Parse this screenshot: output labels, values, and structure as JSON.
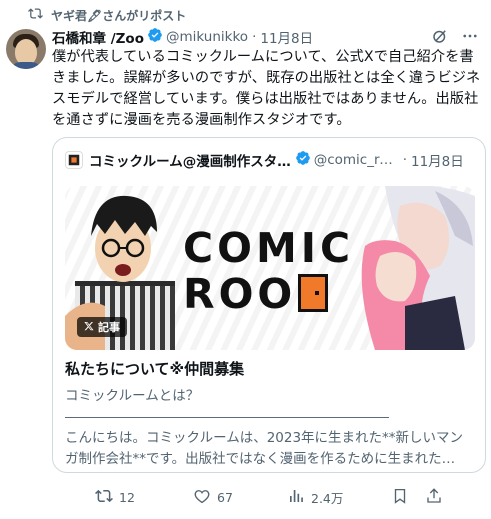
{
  "repost": {
    "icon": "repost-icon",
    "text": "ヤギ君🖋さんがリポスト"
  },
  "author": {
    "name": "石橋和章 /Zoo",
    "handle": "@mikunikko",
    "separator": "·",
    "date": "11月8日"
  },
  "tweet": {
    "text": "僕が代表しているコミックルームについて、公式Xで自己紹介を書きました。誤解が多いのですが、既存の出版社とは全く違うビジネスモデルで経営しています。僕らは出版社ではありません。出版社を通さずに漫画を売る漫画制作スタジオです。"
  },
  "quote": {
    "name": "コミックルーム@漫画制作スタ…",
    "handle": "@comic_ro…",
    "separator": "·",
    "date": "11月8日",
    "image": {
      "logo_line1": "COMIC",
      "logo_line2": "ROO",
      "badge": "記事"
    },
    "article_title": "私たちについて※仲間募集",
    "article_body": "コミックルームとは？\n――――――――――――――――――――――――\nこんにちは。コミックルームは、2023年に生まれた**新しいマンガ制作会社**です。出版社ではなく漫画を作るために生まれた…"
  },
  "actions": {
    "replies": "12",
    "likes": "67",
    "views": "2.4万"
  },
  "colors": {
    "verified": "#1d9bf0",
    "muted": "#536471",
    "border": "#cfd9de",
    "door": "#f07a2a"
  }
}
